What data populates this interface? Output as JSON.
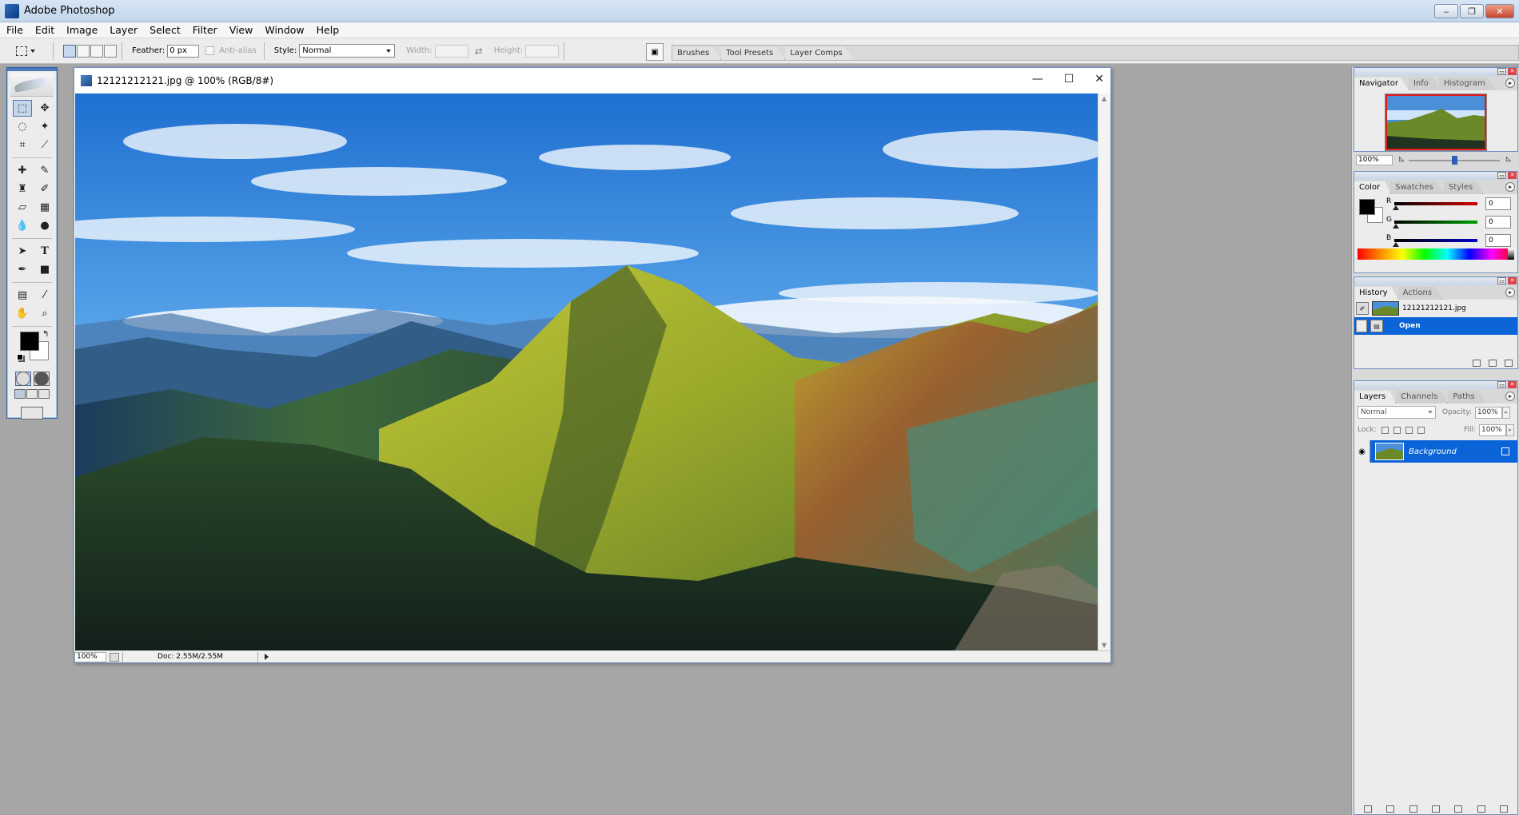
{
  "window": {
    "title": "Adobe Photoshop"
  },
  "menu": [
    "File",
    "Edit",
    "Image",
    "Layer",
    "Select",
    "Filter",
    "View",
    "Window",
    "Help"
  ],
  "options": {
    "feather_label": "Feather:",
    "feather_value": "0 px",
    "antialias_label": "Anti-alias",
    "style_label": "Style:",
    "style_value": "Normal",
    "width_label": "Width:",
    "height_label": "Height:"
  },
  "palette_well": {
    "tabs": [
      "Brushes",
      "Tool Presets",
      "Layer Comps"
    ]
  },
  "document": {
    "title": "12121212121.jpg @ 100% (RGB/8#)",
    "zoom": "100%",
    "doc_size": "Doc: 2.55M/2.55M"
  },
  "navigator": {
    "tabs": [
      "Navigator",
      "Info",
      "Histogram"
    ],
    "zoom": "100%",
    "slider_fraction": 0.5
  },
  "color": {
    "tabs": [
      "Color",
      "Swatches",
      "Styles"
    ],
    "channels": [
      {
        "label": "R",
        "value": "0",
        "color": "#d40000"
      },
      {
        "label": "G",
        "value": "0",
        "color": "#00a000"
      },
      {
        "label": "B",
        "value": "0",
        "color": "#0000c8"
      }
    ],
    "foreground": "#000000",
    "background": "#ffffff"
  },
  "history": {
    "tabs": [
      "History",
      "Actions"
    ],
    "snapshot": "12121212121.jpg",
    "states": [
      "Open"
    ]
  },
  "layers": {
    "tabs": [
      "Layers",
      "Channels",
      "Paths"
    ],
    "blend_mode": "Normal",
    "opacity_label": "Opacity:",
    "opacity": "100%",
    "lock_label": "Lock:",
    "fill_label": "Fill:",
    "fill": "100%",
    "items": [
      "Background"
    ]
  }
}
